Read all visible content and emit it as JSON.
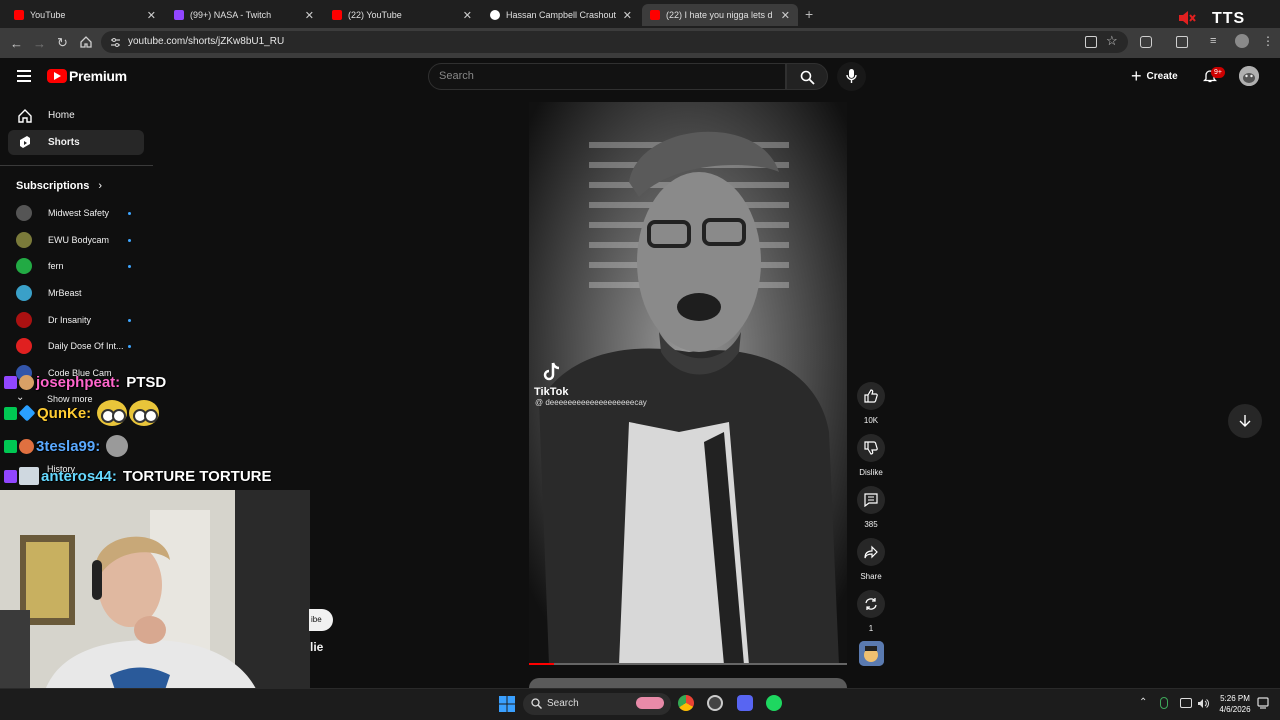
{
  "browser": {
    "tabs": [
      {
        "title": "YouTube",
        "favicon_color": "#ff0000"
      },
      {
        "title": "(99+) NASA - Twitch",
        "favicon_color": "#9146ff"
      },
      {
        "title": "(22) YouTube",
        "favicon_color": "#ff0000"
      },
      {
        "title": "Hassan Campbell Crashout Pira",
        "favicon_color": "#ffffff"
      },
      {
        "title": "(22) I hate you nigga lets d",
        "favicon_color": "#ff0000"
      }
    ],
    "url": "youtube.com/shorts/jZKw8bU1_RU",
    "tts_label": "TTS"
  },
  "youtube": {
    "brand": "Premium",
    "search_placeholder": "Search",
    "create_label": "Create",
    "notification_count": "9+",
    "nav": [
      {
        "label": "Home",
        "icon": "home-icon"
      },
      {
        "label": "Shorts",
        "icon": "shorts-icon"
      }
    ],
    "subscriptions_label": "Subscriptions",
    "subscriptions": [
      {
        "name": "Midwest Safety",
        "color": "#555555"
      },
      {
        "name": "EWU Bodycam",
        "color": "#7a7a3a"
      },
      {
        "name": "fern",
        "color": "#22aa44"
      },
      {
        "name": "MrBeast",
        "color": "#3aa0c8"
      },
      {
        "name": "Dr Insanity",
        "color": "#aa1111"
      },
      {
        "name": "Daily Dose Of Int...",
        "color": "#e02020"
      },
      {
        "name": "Code Blue Cam",
        "color": "#3355aa"
      }
    ],
    "show_more": "Show more",
    "history": "History",
    "peek_subscribe": "ibe",
    "peek_title": "lie"
  },
  "short": {
    "watermark": "TikTok",
    "handle": "@ deeeeeeeeeeeeeeeeeeecay",
    "like_count": "10K",
    "dislike_label": "Dislike",
    "comment_count": "385",
    "share_label": "Share",
    "remix_count": "1",
    "progress": 0.08
  },
  "chat": [
    {
      "user": "josephpeat:",
      "message": "PTSD",
      "user_color": "#ff66cc",
      "badge_color": "#9146ff"
    },
    {
      "user": "QunKe:",
      "message": "",
      "user_color": "#ffcc33",
      "badge_color": "#00c853",
      "emotes": 2
    },
    {
      "user": "3tesla99:",
      "message": "",
      "user_color": "#5aa9ff",
      "badge_color": "#00c853",
      "emotes": 1
    },
    {
      "user": "anteros44:",
      "message": "TORTURE TORTURE",
      "user_color": "#66d9ff",
      "badge_color": "#9146ff"
    }
  ],
  "taskbar": {
    "search_label": "Search",
    "time": "5:26 PM",
    "date": "4/6/2026"
  }
}
